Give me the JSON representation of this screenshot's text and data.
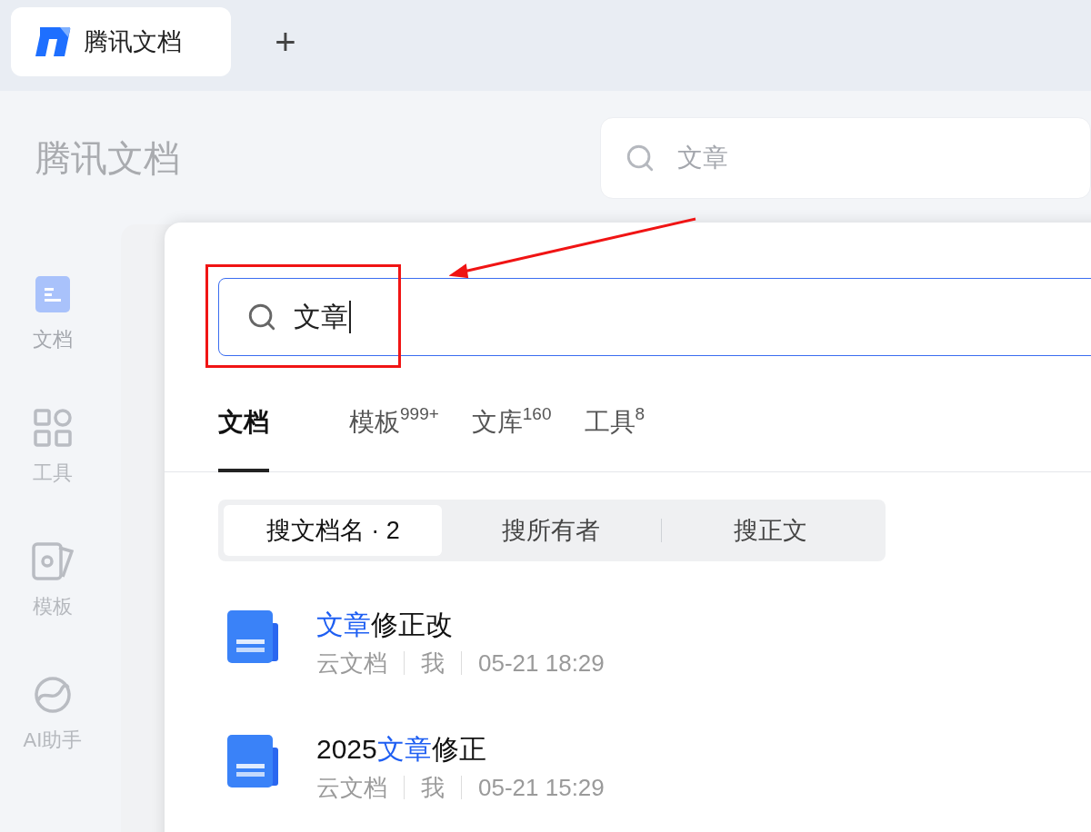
{
  "browser_tab": {
    "title": "腾讯文档",
    "selected": true
  },
  "new_tab_button": "+",
  "app_title": "腾讯文档",
  "header_search": {
    "value": "文章"
  },
  "sidebar": {
    "items": [
      {
        "label": "文档",
        "kind": "doc",
        "selected": true
      },
      {
        "label": "工具",
        "kind": "grid",
        "selected": false
      },
      {
        "label": "模板",
        "kind": "template",
        "selected": false
      },
      {
        "label": "AI助手",
        "kind": "ai",
        "selected": false
      }
    ]
  },
  "search_panel": {
    "query": "文章",
    "tabs": [
      {
        "label": "文档",
        "selected": true
      },
      {
        "label": "模板",
        "count": "999+",
        "selected": false
      },
      {
        "label": "文库",
        "count": "160",
        "selected": false
      },
      {
        "label": "工具",
        "count": "8",
        "selected": false
      }
    ],
    "filters": [
      {
        "label": "搜文档名 · 2",
        "selected": true
      },
      {
        "label": "搜所有者",
        "selected": false
      },
      {
        "label": "搜正文",
        "selected": false
      }
    ],
    "results": [
      {
        "title_parts": [
          {
            "text": "文章",
            "highlight": true
          },
          {
            "text": "修正改",
            "highlight": false
          }
        ],
        "source": "云文档",
        "owner": "我",
        "time": "05-21 18:29"
      },
      {
        "title_parts": [
          {
            "text": "2025",
            "highlight": false
          },
          {
            "text": "文章",
            "highlight": true
          },
          {
            "text": "修正",
            "highlight": false
          }
        ],
        "source": "云文档",
        "owner": "我",
        "time": "05-21 15:29"
      }
    ]
  }
}
